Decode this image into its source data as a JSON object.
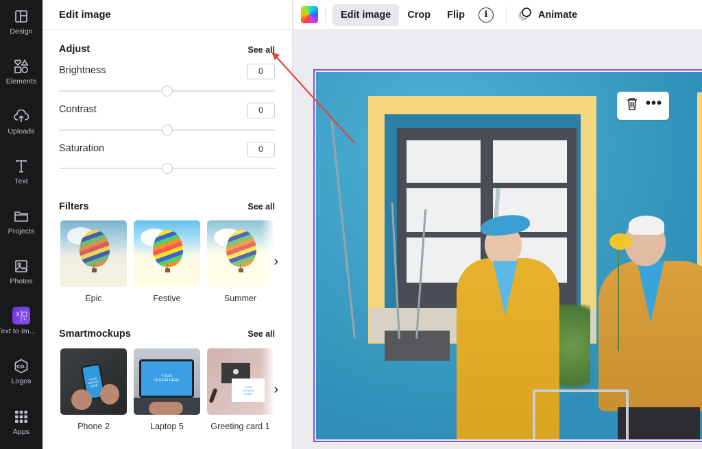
{
  "rail": {
    "items": [
      {
        "label": "Design",
        "icon": "layout-icon"
      },
      {
        "label": "Elements",
        "icon": "shapes-icon"
      },
      {
        "label": "Uploads",
        "icon": "cloud-upload-icon"
      },
      {
        "label": "Text",
        "icon": "text-icon"
      },
      {
        "label": "Projects",
        "icon": "folder-icon"
      },
      {
        "label": "Photos",
        "icon": "image-icon"
      },
      {
        "label": "Text to Im...",
        "icon": "text-to-image-app-icon"
      },
      {
        "label": "Logos",
        "icon": "logo-hexagon-icon"
      },
      {
        "label": "Apps",
        "icon": "apps-grid-icon"
      }
    ]
  },
  "panel": {
    "title": "Edit image",
    "adjust": {
      "title": "Adjust",
      "see_all": "See all",
      "controls": [
        {
          "label": "Brightness",
          "value": "0",
          "level": 0.5
        },
        {
          "label": "Contrast",
          "value": "0",
          "level": 0.5
        },
        {
          "label": "Saturation",
          "value": "0",
          "level": 0.5
        }
      ]
    },
    "filters": {
      "title": "Filters",
      "see_all": "See all",
      "items": [
        {
          "label": "Epic"
        },
        {
          "label": "Festive"
        },
        {
          "label": "Summer"
        }
      ],
      "next_icon": "chevron-right-icon"
    },
    "smartmockups": {
      "title": "Smartmockups",
      "see_all": "See all",
      "items": [
        {
          "label": "Phone 2",
          "screen_text": "YOUR DESIGN HERE"
        },
        {
          "label": "Laptop 5",
          "screen_text": "YOUR DESIGN HERE"
        },
        {
          "label": "Greeting card 1",
          "screen_text": "YOUR DESIGN HERE"
        }
      ],
      "next_icon": "chevron-right-icon"
    }
  },
  "toolbar": {
    "color_icon": "color-picker-icon",
    "edit_image": "Edit image",
    "crop": "Crop",
    "flip": "Flip",
    "info_glyph": "i",
    "animate": "Animate"
  },
  "canvas": {
    "selection_color": "#8b4fe0",
    "float_menu": {
      "delete_icon": "trash-icon",
      "more_glyph": "•••"
    }
  },
  "annotation": {
    "color": "#e0463a",
    "points_to": "Adjust See all"
  }
}
